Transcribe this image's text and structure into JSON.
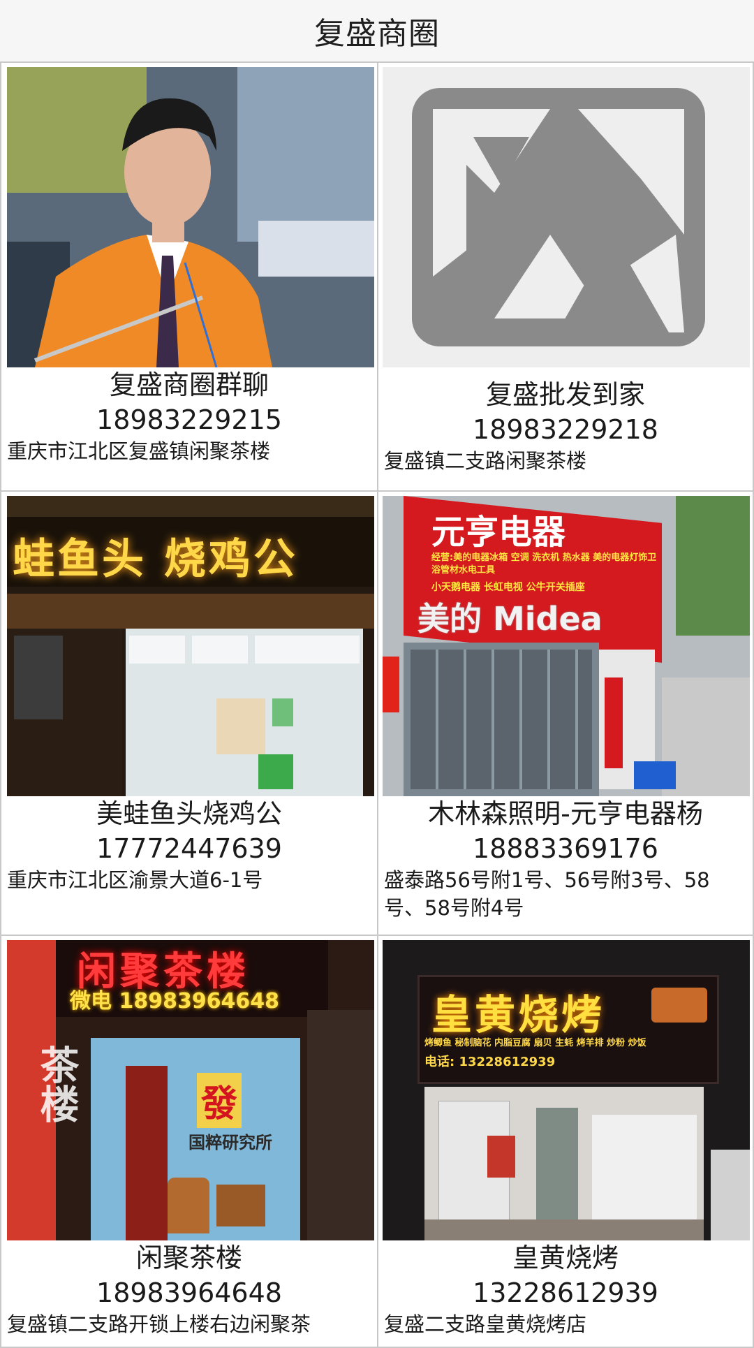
{
  "header": {
    "title": "复盛商圈"
  },
  "cards": [
    {
      "name": "复盛商圈群聊",
      "phone": "18983229215",
      "address": "重庆市江北区复盛镇闲聚茶楼"
    },
    {
      "name": "复盛批发到家",
      "phone": "18983229218",
      "address": "复盛镇二支路闲聚茶楼"
    },
    {
      "name": "美蛙鱼头烧鸡公",
      "phone": "17772447639",
      "address": "重庆市江北区渝景大道6-1号",
      "sign": "蛙鱼头 烧鸡公"
    },
    {
      "name": "木林森照明-元亨电器杨",
      "phone": "18883369176",
      "address": "盛泰路56号附1号、56号附3号、58号、58号附4号",
      "sign": "元亨电器",
      "sign_sub": "经营:美的电器冰箱 空调 洗衣机 热水器 美的电器灯饰卫浴管材水电工具",
      "sign_sub2": "小天鹅电器 长虹电视 公牛开关插座",
      "sign_brand": "美的 Midea"
    },
    {
      "name": "闲聚茶楼",
      "phone": "18983964648",
      "address": "复盛镇二支路开锁上楼右边闲聚茶",
      "sign": "闲聚茶楼",
      "sign_sub": "微电 18983964648",
      "sign_fa": "發",
      "sign_wall": "国粹研究所",
      "sign_side": "茶楼"
    },
    {
      "name": "皇黄烧烤",
      "phone": "13228612939",
      "address": "复盛二支路皇黄烧烤店",
      "sign": "皇黄烧烤",
      "sign_sub": "烤鲫鱼 秘制脑花 内脂豆腐 扇贝 生蚝 烤羊排 炒粉 炒饭",
      "sign_phone": "电话: 13228612939"
    }
  ],
  "colors": {
    "border": "#c8c8c8",
    "placeholder_icon": "#8a8a8a",
    "sign_red": "#d2141e",
    "neon_yellow": "#ffd84a"
  }
}
